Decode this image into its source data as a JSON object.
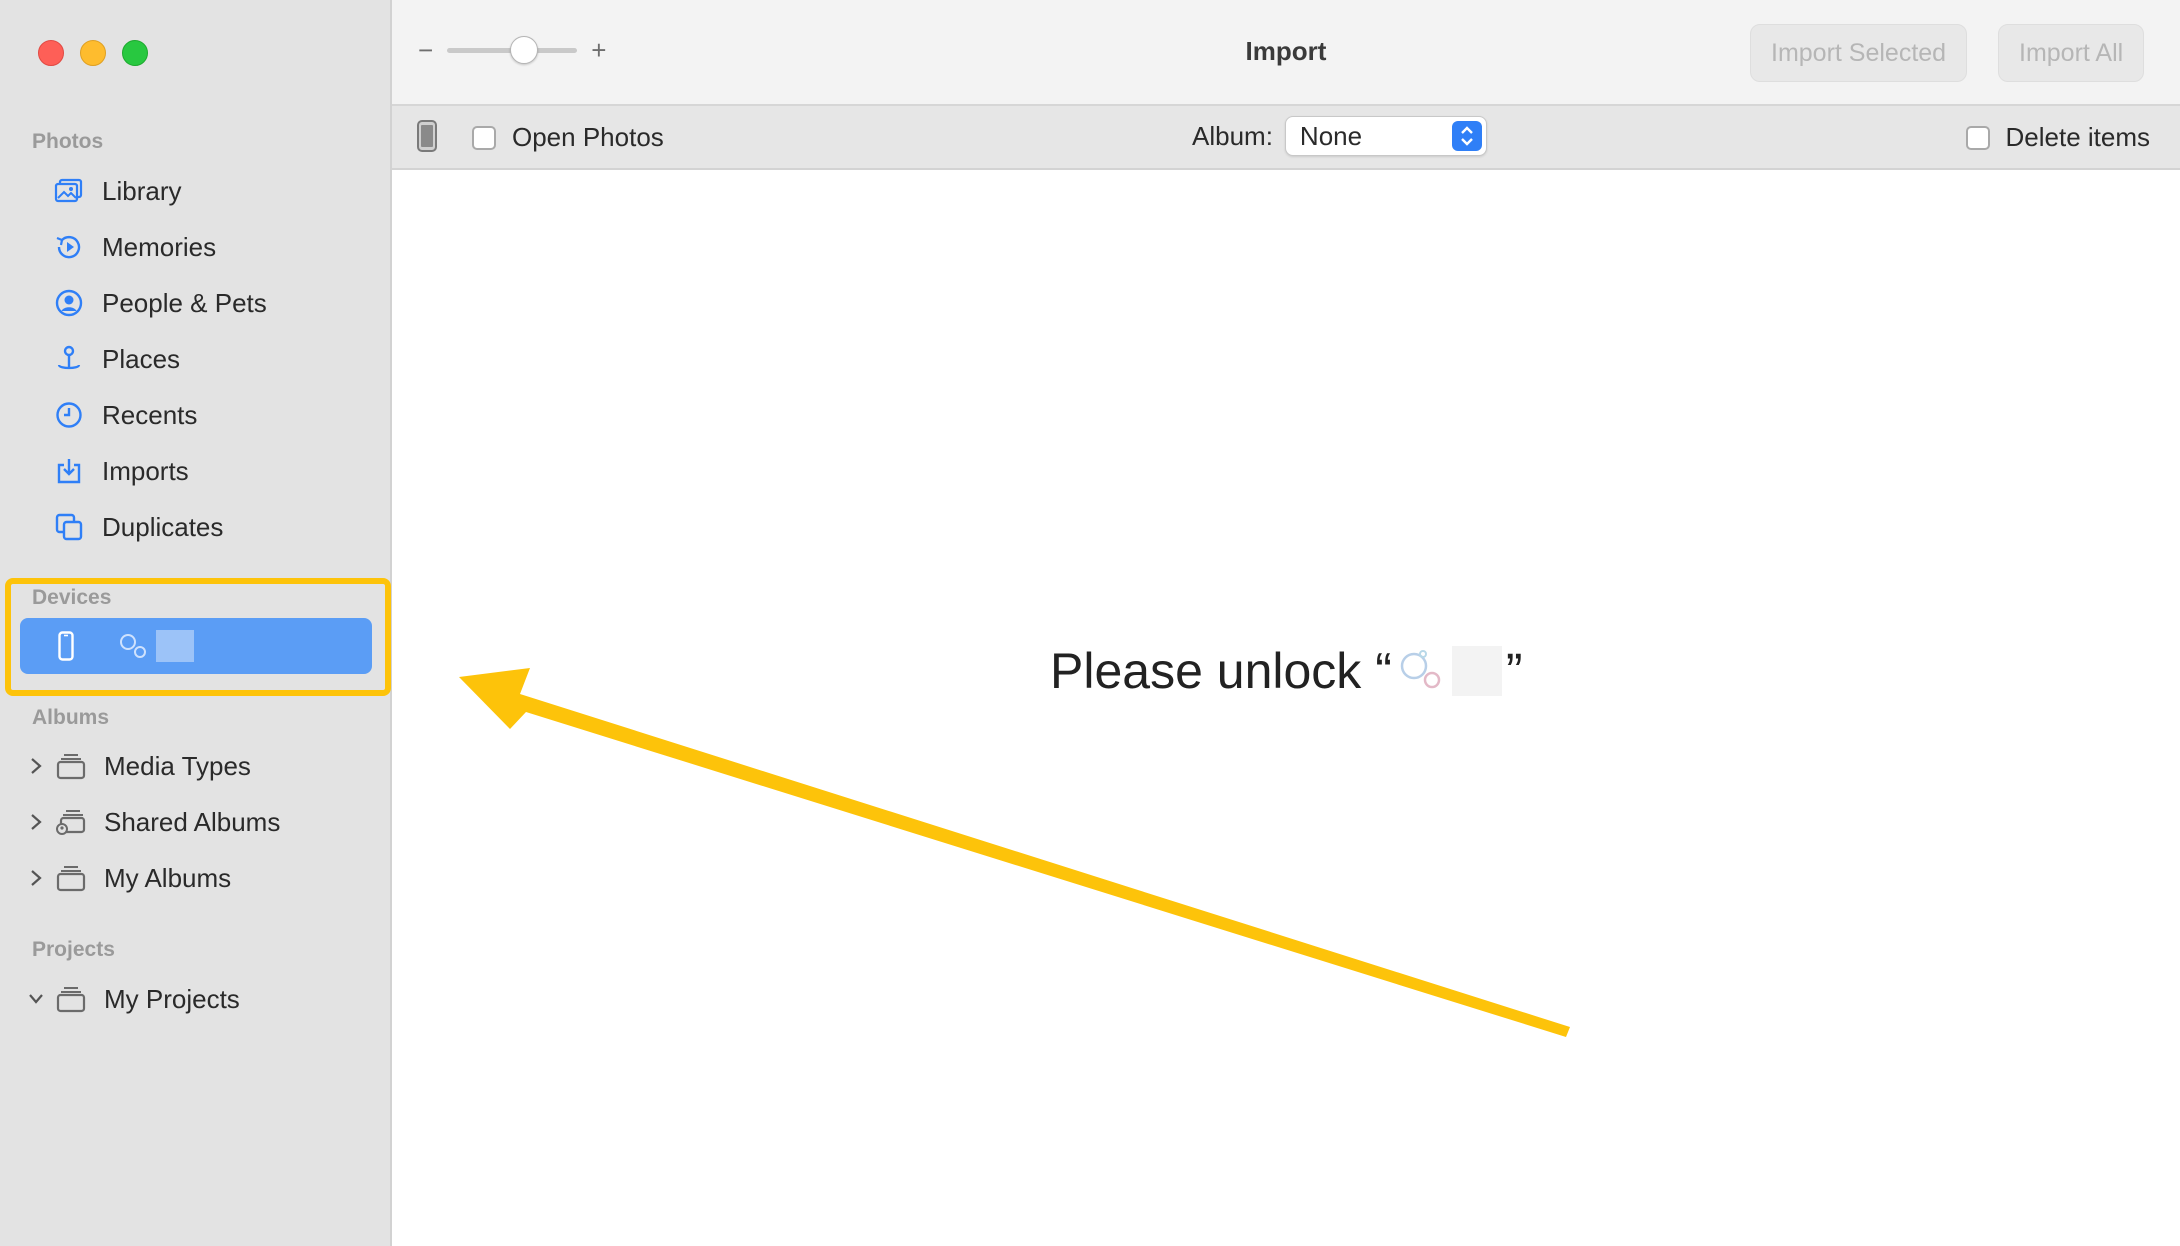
{
  "window": {
    "title": "Import"
  },
  "sidebar": {
    "photos_label": "Photos",
    "photos_items": [
      {
        "label": "Library",
        "icon": "library-icon"
      },
      {
        "label": "Memories",
        "icon": "memories-icon"
      },
      {
        "label": "People & Pets",
        "icon": "people-icon"
      },
      {
        "label": "Places",
        "icon": "places-icon"
      },
      {
        "label": "Recents",
        "icon": "recents-icon"
      },
      {
        "label": "Imports",
        "icon": "imports-icon"
      },
      {
        "label": "Duplicates",
        "icon": "duplicates-icon"
      }
    ],
    "devices_label": "Devices",
    "device": {
      "icon": "iphone-icon",
      "selected": true
    },
    "albums_label": "Albums",
    "album_items": [
      {
        "label": "Media Types",
        "icon": "album-stack-icon",
        "expanded": false
      },
      {
        "label": "Shared Albums",
        "icon": "shared-album-icon",
        "expanded": false
      },
      {
        "label": "My Albums",
        "icon": "album-stack-icon",
        "expanded": false
      }
    ],
    "projects_label": "Projects",
    "project_items": [
      {
        "label": "My Projects",
        "icon": "album-stack-icon",
        "expanded": true
      }
    ]
  },
  "toolbar": {
    "zoom_minus": "−",
    "zoom_plus": "+",
    "zoom_level": 0.55,
    "import_selected_label": "Import Selected",
    "import_all_label": "Import All"
  },
  "options": {
    "open_photos_label": "Open Photos",
    "open_photos_checked": false,
    "album_label": "Album:",
    "album_value": "None",
    "delete_items_label": "Delete items",
    "delete_items_checked": false
  },
  "main": {
    "unlock_prefix": "Please unlock “",
    "unlock_suffix": "”"
  },
  "colors": {
    "sidebar_bg": "#e3e3e3",
    "selection_blue": "#5b9df5",
    "annotation_yellow": "#fdc30a",
    "accent_blue": "#2f7ff7"
  }
}
